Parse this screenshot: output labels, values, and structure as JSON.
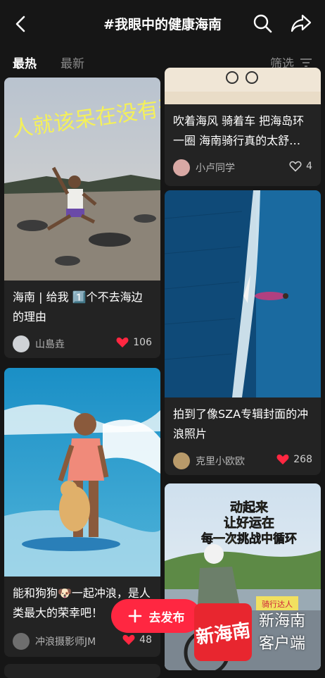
{
  "header": {
    "title": "#我眼中的健康海南"
  },
  "tabs": {
    "hot": "最热",
    "new": "最新",
    "filter": "筛选"
  },
  "cards": [
    {
      "overlay": "人就该呆在没有天花板的地方",
      "caption": "海南 | 给我 1️⃣个不去海边的理由",
      "author": "山島垚",
      "likes": "106",
      "liked": true
    },
    {
      "caption": "能和狗狗🐶一起冲浪，是人类最大的荣幸吧！",
      "author": "冲浪摄影师JM",
      "likes": "48",
      "liked": true
    },
    {
      "caption": "吹着海风 骑着车 把海岛环一圈 海南骑行真的太舒…",
      "author": "小卢同学",
      "likes": "4",
      "liked": false
    },
    {
      "caption": "拍到了像SZA专辑封面的冲浪照片",
      "author": "克里小欧欧",
      "likes": "268",
      "liked": true
    },
    {
      "overlay_line1": "动起来",
      "overlay_line2": "让好运在",
      "overlay_line3": "每一次挑战中循环",
      "badge": "骑行达人"
    }
  ],
  "fab": {
    "label": "去发布"
  },
  "watermark": {
    "logo": "新海南",
    "line1": "新海南",
    "line2": "客户端"
  },
  "colors": {
    "accent": "#ff2741",
    "background": "#161616",
    "card": "#232323"
  }
}
